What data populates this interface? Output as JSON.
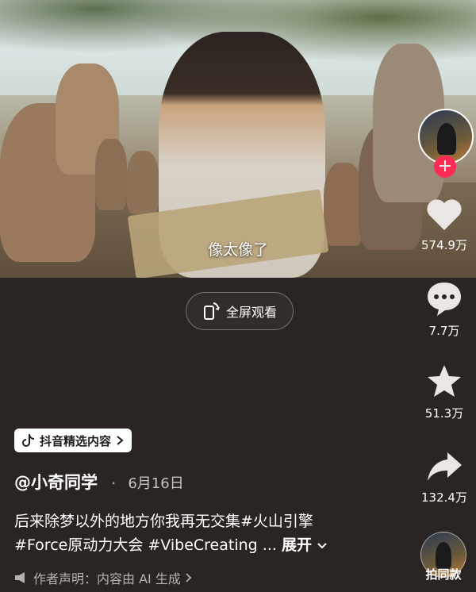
{
  "video": {
    "subtitle": "像太像了"
  },
  "fullscreen_button": {
    "label": "全屏观看",
    "icon": "rotate-phone-icon"
  },
  "actions": {
    "like_count": "574.9万",
    "comment_count": "7.7万",
    "favorite_count": "51.3万",
    "share_count": "132.4万",
    "same_style_label": "拍同款"
  },
  "badge": {
    "label": "抖音精选内容"
  },
  "author": {
    "name": "@小奇同学",
    "separator": "·",
    "date": "6月16日"
  },
  "caption": {
    "line1": "后来除梦以外的地方你我再无交集#火山引擎",
    "line2": "#Force原动力大会 #VibeCreating ...",
    "expand": "展开"
  },
  "disclaimer": {
    "label": "作者声明：内容由 AI 生成"
  },
  "colors": {
    "background": "#2a2422",
    "accent": "#fe2c55"
  }
}
